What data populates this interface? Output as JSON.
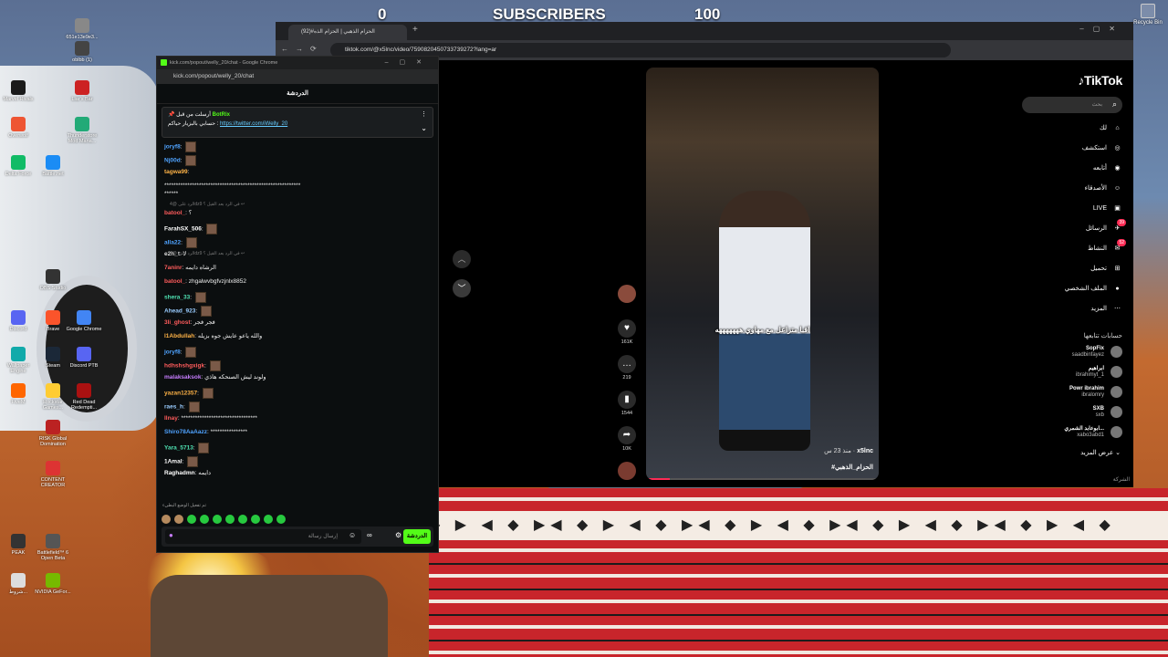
{
  "overlay": {
    "sub_left": "0",
    "sub_title": "SUBSCRIBERS",
    "sub_right": "100"
  },
  "desktop": {
    "recycle": "Recycle Bin",
    "icons": [
      {
        "label": "651e13e9e3..."
      },
      {
        "label": "oblbb (1)"
      },
      {
        "label": "Marvel Rivals"
      },
      {
        "label": "Liar's Bar"
      },
      {
        "label": "Overwolf"
      },
      {
        "label": "Thunderstore Mod Mana..."
      },
      {
        "label": "Delta Force"
      },
      {
        "label": "Battle.net"
      },
      {
        "label": "OBS Studio"
      },
      {
        "label": "Discord"
      },
      {
        "label": "Brave"
      },
      {
        "label": "Google Chrome"
      },
      {
        "label": "Wallpaper Engine"
      },
      {
        "label": "Steam"
      },
      {
        "label": "Discord PTB"
      },
      {
        "label": "FiveM"
      },
      {
        "label": "Rockstar Games..."
      },
      {
        "label": "Red Dead Redempti..."
      },
      {
        "label": "RISK Global Domination"
      },
      {
        "label": "CONTENT CREATOR"
      },
      {
        "label": "PEAK"
      },
      {
        "label": "Battlefield™ 6 Open Beta"
      },
      {
        "label": "NVIDIA GeFor..."
      },
      {
        "label": "شروط..."
      }
    ]
  },
  "tiktok": {
    "tab_title": "الحزام الذهبي | الحزام الذه#(92)",
    "url": "tiktok.com/@x5lnc/video/7590820450733739272?lang=ar",
    "logo": "TikTok",
    "search_placeholder": "بحث",
    "nav": [
      {
        "label": "لك",
        "icon": "⌂"
      },
      {
        "label": "استكشف",
        "icon": "◎"
      },
      {
        "label": "أتابعه",
        "icon": "◉"
      },
      {
        "label": "الأصدقاء",
        "icon": "☺"
      },
      {
        "label": "LIVE",
        "icon": "▣"
      },
      {
        "label": "الرسائل",
        "icon": "✈",
        "badge": "39"
      },
      {
        "label": "النشاط",
        "icon": "✉",
        "badge": "52"
      },
      {
        "label": "تحميل",
        "icon": "⊞"
      },
      {
        "label": "الملف الشخصي",
        "icon": "●"
      },
      {
        "label": "المزيد",
        "icon": "⋯"
      }
    ],
    "following_title": "حسابات تتابعها",
    "following": [
      {
        "name": "SopFix",
        "handle": "saadbinfayez"
      },
      {
        "name": "ابراهيم",
        "handle": "ibrahimyt_1"
      },
      {
        "name": "Powr ibrahim",
        "handle": "ibralomry"
      },
      {
        "name": "SXB",
        "handle": "sxb"
      },
      {
        "name": "ابوعابد الشمري...",
        "handle": "xabo3abd1"
      }
    ],
    "see_more": "عرض المزيد",
    "copyright": "الشركة",
    "video": {
      "caption": "اقبا متزاعل مع مهاوي هههههههه",
      "author": "x5lnc",
      "time": "منذ 23 س",
      "tag": "#الحزام_الذهبي"
    },
    "actions": {
      "likes": "161K",
      "comments": "219",
      "saves": "1544",
      "shares": "10K"
    },
    "progress": 0.1
  },
  "kick": {
    "window_title": "kick.com/popout/welly_20/chat - Google Chrome",
    "url": "kick.com/popout/welly_20/chat",
    "header": "الدردشة",
    "pinned": {
      "by": "أرسلت من قبل",
      "bot": "BotRix",
      "text": "حسابي بالبزيار حياكم :",
      "link": "https://twitter.com/iWelly_20"
    },
    "messages": [
      {
        "user": "joryf8",
        "color": "#4fa3ff",
        "text": "",
        "emote": true
      },
      {
        "user": "Nj00d",
        "color": "#4fa3ff",
        "text": "",
        "emote": true
      },
      {
        "user": "tagwa99",
        "color": "#ffb347",
        "text": ""
      },
      {
        "user": "",
        "color": "#fff",
        "text": "***********************************************************"
      },
      {
        "user": "",
        "color": "#fff",
        "text": "******"
      },
      {
        "user": "batool_",
        "color": "#ff5c5c",
        "text": "؟"
      },
      {
        "user": "FarahSX_506",
        "color": "#fff",
        "text": "",
        "emote": true
      },
      {
        "user": "alla22",
        "color": "#4fa3ff",
        "text": "",
        "emote": true
      },
      {
        "user": "e2h_t",
        "color": "#ddd",
        "text": "لا"
      },
      {
        "user": "7aninr",
        "color": "#ff5c5c",
        "text": "الرشاه دايمه"
      },
      {
        "user": "batool_",
        "color": "#ff5c5c",
        "text": "zhgalwvbgfvzjnlx8852"
      },
      {
        "user": "shera_33",
        "color": "#4fe3b3",
        "text": "",
        "emote": true
      },
      {
        "user": "Ahead_923",
        "color": "#9cf",
        "text": "",
        "emote": true
      },
      {
        "user": "3li_ghost",
        "color": "#ff5c5c",
        "text": "فجر فجر"
      },
      {
        "user": "l1Abdullah",
        "color": "#ffb347",
        "text": "والله ياعو عايش جوه بزيله"
      },
      {
        "user": "joryf8",
        "color": "#4fa3ff",
        "text": "",
        "emote": true
      },
      {
        "user": "hdhshshgxigk",
        "color": "#ff5c5c",
        "text": "",
        "emote": true
      },
      {
        "user": "malaksaksok",
        "color": "#c77dff",
        "text": "ولوند ليش الصنحكه هاذي"
      },
      {
        "user": "yazan12357",
        "color": "#ffb347",
        "text": "",
        "emote": true
      },
      {
        "user": "raes_h",
        "color": "#9cf",
        "text": "",
        "emote": true
      },
      {
        "user": "llnay",
        "color": "#ff5c5c",
        "text": "*********************************"
      },
      {
        "user": "Shiro78AaAazz",
        "color": "#4fa3ff",
        "text": "****************"
      },
      {
        "user": "Yara_5713",
        "color": "#4fe3b3",
        "text": "",
        "emote": true
      },
      {
        "user": "1Amal",
        "color": "#fff",
        "text": "",
        "emote": true
      },
      {
        "user": "Raghadmn",
        "color": "#fff",
        "text": "دايمه"
      }
    ],
    "replies": [
      {
        "text": "الرد على @4dz9 في الرد بعد القيل ؟ ↩"
      },
      {
        "text": "الرد على @4dz9 في الرد بعد القيل ؟ ↩"
      }
    ],
    "emotes_label": "تم تفعيل الوضع البطيء",
    "input_placeholder": "إرسال رسالة",
    "send": "الدردشة"
  }
}
